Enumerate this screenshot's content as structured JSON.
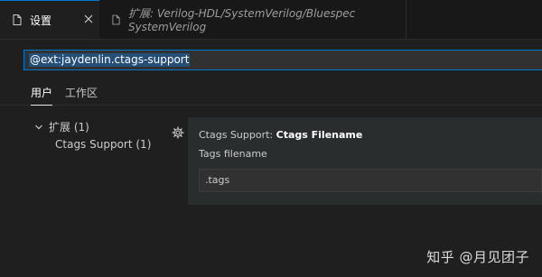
{
  "tabs": [
    {
      "label": "设置",
      "active": true,
      "icon": "document-icon"
    },
    {
      "label": "扩展: Verilog-HDL/SystemVerilog/Bluespec SystemVerilog",
      "active": false,
      "icon": "document-icon"
    }
  ],
  "search": {
    "value": "@ext:jaydenlin.ctags-support"
  },
  "scope_tabs": [
    "用户",
    "工作区"
  ],
  "toc": {
    "extensions_label": "扩展 (1)",
    "item_label": "Ctags Support (1)"
  },
  "setting": {
    "category": "Ctags Support: ",
    "name": "Ctags Filename",
    "description": "Tags filename",
    "value": ".tags"
  },
  "watermark": "知乎 @月见团子",
  "colors": {
    "accent": "#0078d4",
    "background": "#1f1f1f",
    "panel": "#2a2d2e",
    "selection": "#264f78"
  }
}
